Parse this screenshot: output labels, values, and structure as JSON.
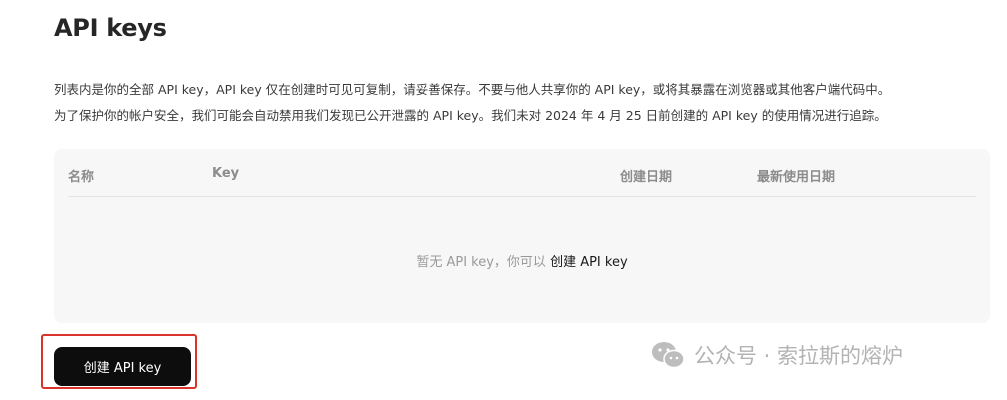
{
  "page": {
    "title": "API keys",
    "description_line1": "列表内是你的全部 API key，API key 仅在创建时可见可复制，请妥善保存。不要与他人共享你的 API key，或将其暴露在浏览器或其他客户端代码中。",
    "description_line2": "为了保护你的帐户安全，我们可能会自动禁用我们发现已公开泄露的 API key。我们未对 2024 年 4 月 25 日前创建的 API key 的使用情况进行追踪。"
  },
  "table": {
    "columns": [
      "名称",
      "Key",
      "创建日期",
      "最新使用日期"
    ],
    "rows": [],
    "empty_text": "暂无 API key，你可以",
    "empty_link": "创建 API key"
  },
  "actions": {
    "create_button_label": "创建 API key"
  },
  "watermark": {
    "icon": "wechat-icon",
    "text": "公众号 · 索拉斯的熔炉"
  },
  "colors": {
    "button_bg": "#0d0d0d",
    "table_bg": "#f7f7f8",
    "highlight_border": "#d9332b"
  }
}
